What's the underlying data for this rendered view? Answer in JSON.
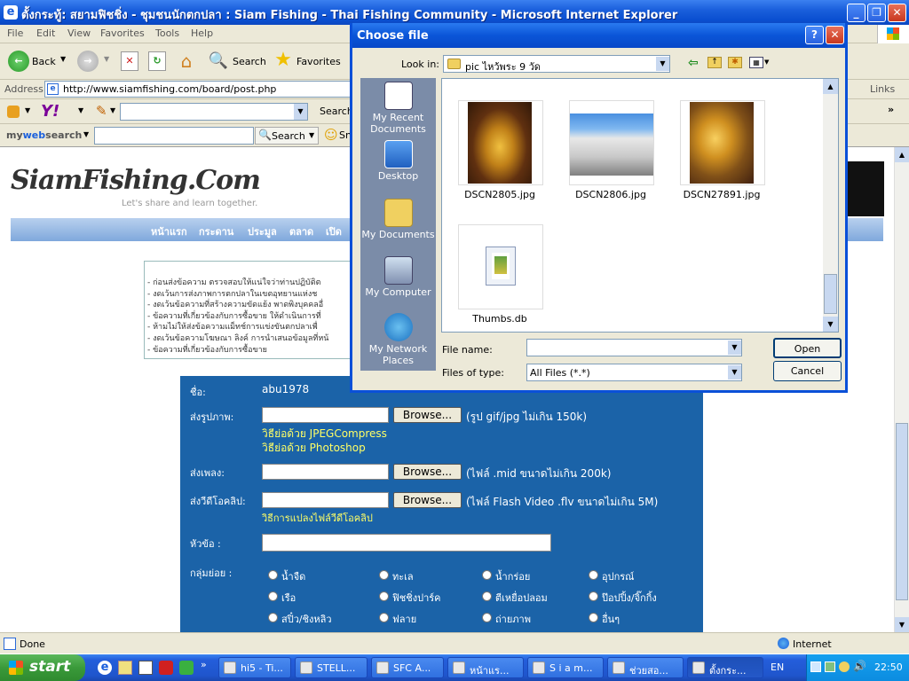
{
  "window": {
    "title": "ตั้งกระทู้: สยามฟิชชิ่ง - ชุมชนนักตกปลา : Siam Fishing - Thai Fishing Community - Microsoft Internet Explorer"
  },
  "menu": [
    "File",
    "Edit",
    "View",
    "Favorites",
    "Tools",
    "Help"
  ],
  "toolbar": {
    "back": "Back",
    "search": "Search",
    "favorites": "Favorites"
  },
  "address": {
    "label": "Address",
    "url": "http://www.siamfishing.com/board/post.php",
    "links": "Links"
  },
  "yahoo": {
    "search": "Search"
  },
  "mywebsearch": {
    "logo_my": "my",
    "logo_web": "web",
    "logo_search": "search",
    "search": "Search",
    "smiley_text": "Sn"
  },
  "site": {
    "logo": "SiamFishing.Com",
    "tagline": "Let's share and learn together.",
    "nav": [
      "หน้าแรก",
      "กระดาน",
      "ประมูล",
      "ตลาด",
      "เปิด"
    ],
    "rules": [
      "- ก่อนส่งข้อความ ตรวจสอบให้แน่ใจว่าท่านปฏิบัติต",
      "- งดเว้นการส่งภาพการตกปลาในเขตอุทยานแห่งช",
      "- งดเว้นข้อความที่สร้างความขัดแย้ง พาดพิงบุคคลอื่",
      "- ข้อความที่เกี่ยวข้องกับการซื้อขาย ให้ดำเนินการที่",
      "- ห้ามไม่ให้ส่งข้อความแม็ทช์การแข่งขันตกปลาเพื่",
      "- งดเว้นข้อความโฆษณา ลิงค์ การนำเสนอข้อมูลที่หน้",
      "- ข้อความที่เกี่ยวข้องกับการซื้อขาย"
    ],
    "form": {
      "name_label": "ชื่อ:",
      "name_value": "abu1978",
      "image_label": "ส่งรูปภาพ:",
      "browse": "Browse...",
      "image_hint": "(รูป gif/jpg ไม่เกิน 150k)",
      "jpeg_link": "วิธีย่อด้วย JPEGCompress",
      "ps_link": "วิธีย่อด้วย Photoshop",
      "music_label": "ส่งเพลง:",
      "music_hint": "(ไฟล์ .mid ขนาดไม่เกิน 200k)",
      "video_label": "ส่งวีดีโอคลิป:",
      "video_hint": "(ไฟล์ Flash Video .flv ขนาดไม่เกิน 5M)",
      "video_link": "วิธีการแปลงไฟล์วีดีโอคลิป",
      "subject_label": "หัวข้อ :",
      "group_label": "กลุ่มย่อย :",
      "groups": [
        "น้ำจืด",
        "ทะเล",
        "น้ำกร่อย",
        "อุปกรณ์",
        "เรือ",
        "ฟิชชิ่งปาร์ค",
        "ตีเหยื่อปลอม",
        "ป๊อปปิ้ง/จิ๊กกิ้ง",
        "สปิ๋ว/ชิงหลิว",
        "ฟลาย",
        "ถ่ายภาพ",
        "อื่นๆ"
      ]
    }
  },
  "status": {
    "done": "Done",
    "zone": "Internet"
  },
  "taskbar": {
    "start": "start",
    "tasks": [
      "hi5 - Ti...",
      "STELL...",
      "SFC A...",
      "หน้าแร...",
      "S i a m...",
      "ช่วยสอ...",
      "ตั้งกระ..."
    ],
    "lang": "EN",
    "time": "22:50"
  },
  "dialog": {
    "title": "Choose file",
    "look_in_label": "Look in:",
    "look_in_value": "pic ไหว้พระ 9 วัด",
    "places": [
      "My Recent Documents",
      "Desktop",
      "My Documents",
      "My Computer",
      "My Network Places"
    ],
    "files": [
      "DSCN2805.jpg",
      "DSCN2806.jpg",
      "DSCN27891.jpg",
      "Thumbs.db"
    ],
    "file_name_label": "File name:",
    "file_name_value": "",
    "files_type_label": "Files of type:",
    "files_type_value": "All Files (*.*)",
    "open": "Open",
    "cancel": "Cancel",
    "help": "?",
    "close": "✕"
  },
  "colors": {
    "xp_blue": "#0a55d8",
    "form_bg": "#1b63a8",
    "link_yellow": "#ffff66",
    "start_green": "#3a9a3a"
  }
}
